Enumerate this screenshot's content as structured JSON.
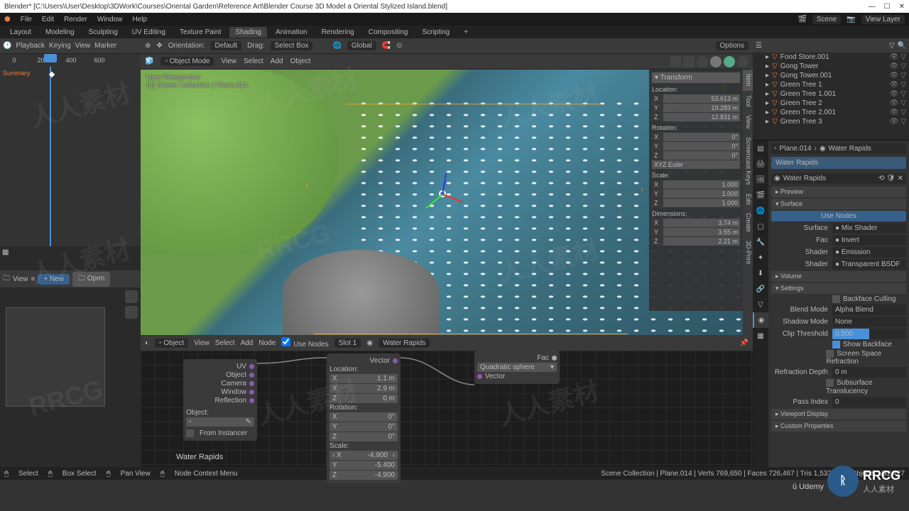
{
  "title": "Blender* [C:\\Users\\User\\Desktop\\3DWork\\Courses\\Oriental Garden\\Reference Art\\Blender Course 3D Model a Oriental Stylized Island.blend]",
  "menubar": [
    "File",
    "Edit",
    "Render",
    "Window",
    "Help"
  ],
  "menubar_right": {
    "scene": "Scene",
    "layer": "View Layer"
  },
  "workspaces": [
    "Layout",
    "Modeling",
    "Sculpting",
    "UV Editing",
    "Texture Paint",
    "Shading",
    "Animation",
    "Rendering",
    "Compositing",
    "Scripting"
  ],
  "workspace_active": "Shading",
  "timeline": {
    "playback": "Playback",
    "keying": "Keying",
    "view": "View",
    "marker": "Marker",
    "ruler": [
      "0",
      "200",
      "400",
      "600"
    ],
    "summary": "Summary"
  },
  "filebrowser": {
    "view": "View",
    "new": "New",
    "open": "Open"
  },
  "vp_header": {
    "orientation": "Orientation:",
    "preset": "Default",
    "drag": "Drag:",
    "drag_mode": "Select Box",
    "global": "Global",
    "options": "Options"
  },
  "vp_header2": {
    "mode": "Object Mode",
    "items": [
      "View",
      "Select",
      "Add",
      "Object"
    ]
  },
  "vp_label1": "User Perspective",
  "vp_label2": "(0) Scene Collection | Plane.014",
  "npanel": {
    "title": "Transform",
    "loc_label": "Location:",
    "loc": {
      "x": "53.613 m",
      "y": "19.283 m",
      "z": "12.831 m"
    },
    "rot_label": "Rotation:",
    "rot": {
      "x": "0°",
      "y": "0°",
      "z": "0°"
    },
    "mode": "XYZ Euler",
    "scale_label": "Scale:",
    "scale": {
      "x": "1.000",
      "y": "1.000",
      "z": "1.000"
    },
    "dim_label": "Dimensions:",
    "dim": {
      "x": "3.74 m",
      "y": "3.55 m",
      "z": "2.21 m"
    }
  },
  "ntabs": [
    "Item",
    "Tool",
    "View",
    "Screencast Keys",
    "Edit",
    "Create",
    "3D-Print"
  ],
  "node_header": {
    "type": "Object",
    "items": [
      "View",
      "Select",
      "Add",
      "Node"
    ],
    "use_nodes": "Use Nodes",
    "slot": "Slot 1",
    "mat": "Water Rapids"
  },
  "node_tex": {
    "rows": [
      "UV",
      "Object",
      "Camera",
      "Window",
      "Reflection"
    ],
    "object": "Object:",
    "instancer": "From Instancer"
  },
  "node_map": {
    "vector": "Vector",
    "loc": "Location:",
    "lx": "1.1 m",
    "ly": "2.9 m",
    "lz": "0 m",
    "rot": "Rotation:",
    "rx": "0°",
    "ry": "0°",
    "rz": "0°",
    "scale": "Scale:",
    "sx": "-4.900",
    "sy": "-5.400",
    "sz": "-4.900"
  },
  "node_grad": {
    "type": "Quadratic sphere",
    "vector": "Vector",
    "fac": "Fac"
  },
  "node_label": "Water Rapids",
  "outliner": {
    "items": [
      {
        "name": "Food Store.001"
      },
      {
        "name": "Gong Tower"
      },
      {
        "name": "Gong Tower.001"
      },
      {
        "name": "Green Tree 1"
      },
      {
        "name": "Green Tree 1.001"
      },
      {
        "name": "Green Tree 2"
      },
      {
        "name": "Green Tree 2.001"
      },
      {
        "name": "Green Tree 3"
      }
    ]
  },
  "props": {
    "crumb_obj": "Plane.014",
    "crumb_mat": "Water Rapids",
    "slot": "Water Rapids",
    "mat_name": "Water Rapids",
    "preview": "Preview",
    "surface": "Surface",
    "volume": "Volume",
    "settings": "Settings",
    "use_nodes": "Use Nodes",
    "surf_lbl": "Surface",
    "surf_val": "Mix Shader",
    "fac_lbl": "Fac",
    "fac_val": "Invert",
    "sh1_lbl": "Shader",
    "sh1_val": "Emission",
    "sh2_lbl": "Shader",
    "sh2_val": "Transparent BSDF",
    "backface": "Backface Culling",
    "blend_lbl": "Blend Mode",
    "blend_val": "Alpha Blend",
    "shadow_lbl": "Shadow Mode",
    "shadow_val": "None",
    "clip_lbl": "Clip Threshold",
    "clip_val": "0.500",
    "show_bf": "Show Backface",
    "ssr": "Screen Space Refraction",
    "refr_lbl": "Refraction Depth",
    "refr_val": "0 m",
    "subsurf": "Subsurface Translucency",
    "pass_lbl": "Pass Index",
    "pass_val": "0",
    "vp_display": "Viewport Display",
    "custom": "Custom Properties"
  },
  "status": {
    "left": [
      "Select",
      "Box Select",
      "Pan View",
      "Node Context Menu"
    ],
    "right": "Scene Collection | Plane.014 | Verts 769,650 | Faces 726,467 | Tris 1,533,423 | Objects 1/32,427"
  },
  "logo": {
    "big": "RRCG",
    "small": "人人素材"
  }
}
